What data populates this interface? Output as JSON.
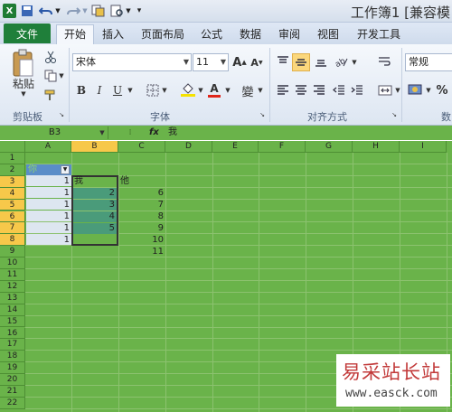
{
  "titlebar": {
    "app_icon": "X",
    "title": "工作簿1 [兼容模",
    "qat": [
      "save-icon",
      "undo-icon",
      "redo-icon",
      "copy-icon",
      "print-preview-icon"
    ]
  },
  "ribbon_tabs": [
    "文件",
    "开始",
    "插入",
    "页面布局",
    "公式",
    "数据",
    "审阅",
    "视图",
    "开发工具"
  ],
  "ribbon": {
    "paste_label": "粘贴",
    "clipboard_label": "剪贴板",
    "font_name": "宋体",
    "font_size": "11",
    "font_group_label": "字体",
    "align_group_label": "对齐方式",
    "number_format": "常规",
    "number_group_label": "数",
    "bold": "B",
    "italic": "I",
    "underline": "U",
    "grow_font": "A",
    "shrink_font": "A",
    "font_color_letter": "A",
    "phonetic": "變",
    "percent": "%"
  },
  "formula_bar": {
    "name_box": "B3",
    "fx": "fx",
    "value": "我"
  },
  "columns": [
    "A",
    "B",
    "C",
    "D",
    "E",
    "F",
    "G",
    "H",
    "I"
  ],
  "rows": [
    "1",
    "2",
    "3",
    "4",
    "5",
    "6",
    "7",
    "8",
    "9",
    "10",
    "11",
    "12",
    "13",
    "14",
    "15",
    "16",
    "17",
    "18",
    "19",
    "20",
    "21",
    "22"
  ],
  "cells": {
    "A2": "你",
    "A3": "1",
    "A4": "1",
    "A5": "1",
    "A6": "1",
    "A7": "1",
    "A8": "1",
    "B3": "我",
    "B4": "2",
    "B5": "3",
    "B6": "4",
    "B7": "5",
    "C3": "他",
    "C4": "6",
    "C5": "7",
    "C6": "8",
    "C7": "9",
    "C8": "10",
    "C9": "11"
  },
  "watermark": {
    "cn": "易采站长站",
    "url": "www.easck.com"
  },
  "colors": {
    "sheet_bg": "#6ab34a",
    "file_tab": "#1f7f3a",
    "selected_header": "#f7c84a",
    "header_blue": "#5a8dc8",
    "selected_fill": "#4a9b7a"
  }
}
